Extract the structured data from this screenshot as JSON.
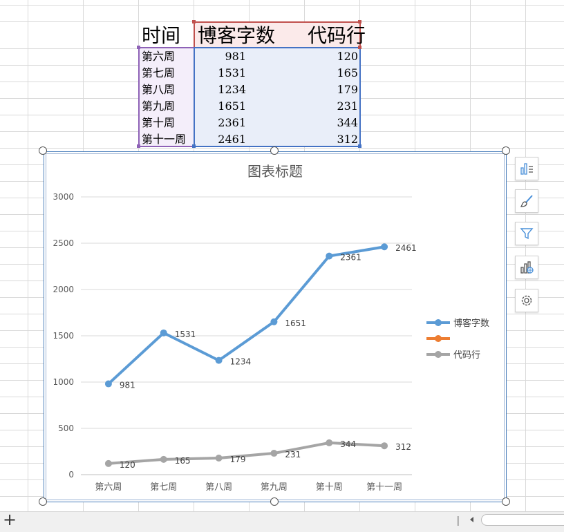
{
  "table": {
    "headers": [
      "时间",
      "博客字数",
      "代码行"
    ],
    "rows": [
      {
        "label": "第六周",
        "words": "981",
        "lines": "120"
      },
      {
        "label": "第七周",
        "words": "1531",
        "lines": "165"
      },
      {
        "label": "第八周",
        "words": "1234",
        "lines": "179"
      },
      {
        "label": "第九周",
        "words": "1651",
        "lines": "231"
      },
      {
        "label": "第十周",
        "words": "2361",
        "lines": "344"
      },
      {
        "label": "第十一周",
        "words": "2461",
        "lines": "312"
      }
    ]
  },
  "chart_data": {
    "type": "line",
    "title": "图表标题",
    "categories": [
      "第六周",
      "第七周",
      "第八周",
      "第九周",
      "第十周",
      "第十一周"
    ],
    "series": [
      {
        "name": "博客字数",
        "color": "#5b9bd5",
        "values": [
          981,
          1531,
          1234,
          1651,
          2361,
          2461
        ],
        "data_labels": true
      },
      {
        "name": "",
        "color": "#ed7d31",
        "values": [],
        "data_labels": false
      },
      {
        "name": "代码行",
        "color": "#a5a5a5",
        "values": [
          120,
          165,
          179,
          231,
          344,
          312
        ],
        "data_labels": true
      }
    ],
    "ylim": [
      0,
      3000
    ],
    "yticks": [
      0,
      500,
      1000,
      1500,
      2000,
      2500,
      3000
    ],
    "grid": true,
    "legend": "right"
  },
  "side_buttons": [
    "chart-elements-icon",
    "chart-styles-icon",
    "chart-filters-icon",
    "chart-type-icon",
    "settings-icon"
  ],
  "bottom": {
    "add_sheet": "+"
  }
}
